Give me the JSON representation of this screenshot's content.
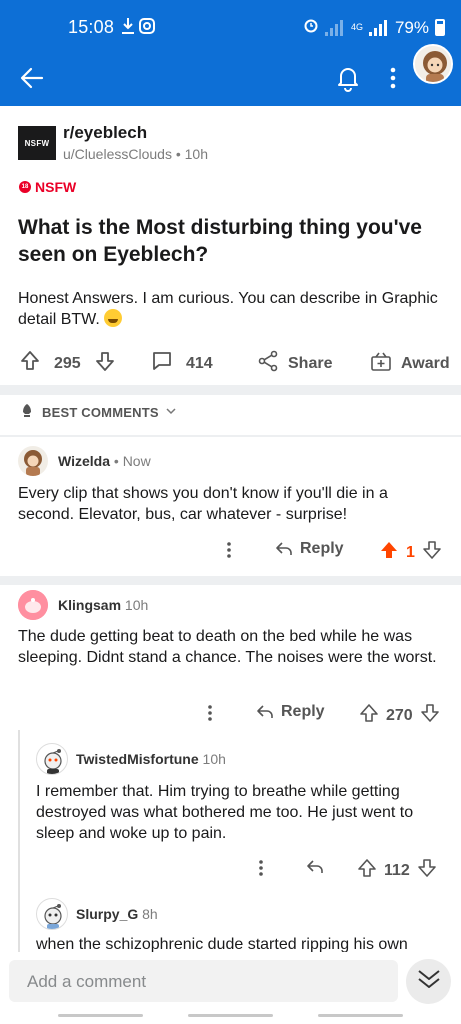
{
  "status_bar": {
    "time": "15:08",
    "network": "4G",
    "battery": "79%"
  },
  "header": {
    "back_icon": "arrow-left-icon",
    "bell_icon": "bell-icon",
    "more_icon": "kebab-icon",
    "avatar": "user-avatar"
  },
  "post": {
    "nsfw_box_label": "NSFW",
    "subreddit": "r/eyeblech",
    "author": "u/CluelessClouds",
    "time": "10h",
    "nsfw_tag": "NSFW",
    "nsfw_dot": "18",
    "title": "What is the Most disturbing thing you've seen on Eyeblech?",
    "body": "Honest Answers. I am curious. You can describe in Graphic detail BTW.",
    "upvotes": "295",
    "comments": "414",
    "share_label": "Share",
    "award_label": "Award"
  },
  "sort": {
    "label": "BEST COMMENTS"
  },
  "comments": [
    {
      "user": "Wizelda",
      "time": "Now",
      "text": "Every clip that shows you don't know if you'll die in a second. Elevator, bus, car whatever - surprise!",
      "reply_label": "Reply",
      "votes": "1"
    },
    {
      "user": "Klingsam",
      "time": "10h",
      "text": "The dude getting beat to death on the bed while he was sleeping. Didnt stand a chance. The noises were the worst.",
      "reply_label": "Reply",
      "votes": "270"
    },
    {
      "user": "TwistedMisfortune",
      "time": "10h",
      "text": "I remember that. Him trying to breathe while getting destroyed was what bothered me too. He just went to sleep and woke up to pain.",
      "votes": "112"
    },
    {
      "user": "Slurpy_G",
      "time": "8h",
      "text": "when the schizophrenic dude started ripping his own"
    }
  ],
  "bottom": {
    "comment_placeholder": "Add a comment"
  },
  "colors": {
    "header_blue": "#0d6fd6",
    "nsfw_red": "#ea0027",
    "upvote_orange": "#ff4500"
  }
}
